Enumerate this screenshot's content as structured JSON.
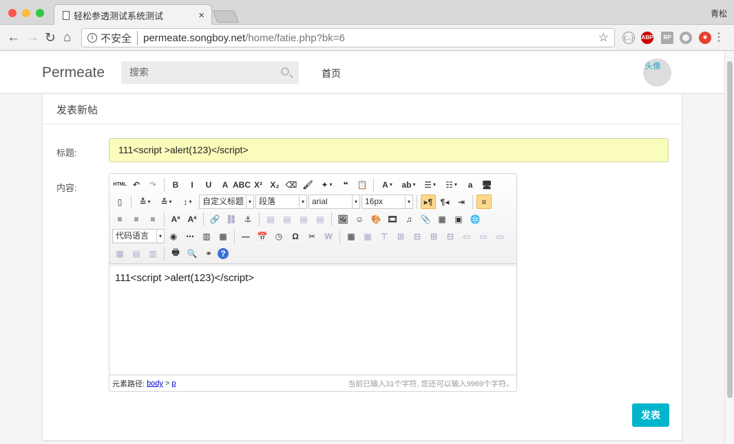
{
  "browser": {
    "tab_title": "轻松参透测试系统测试",
    "user": "青松",
    "security": "不安全",
    "url_host": "permeate.songboy.net",
    "url_path": "/home/fatie.php?bk=6"
  },
  "navbar": {
    "brand": "Permeate",
    "search_placeholder": "搜索",
    "home": "首页",
    "avatar_alt": "头像"
  },
  "form": {
    "heading": "发表新帖",
    "title_label": "标题:",
    "title_value": "111<script >alert(123)</script>",
    "content_label": "内容:",
    "submit": "发表"
  },
  "editor": {
    "selects": {
      "heading": "自定义标题",
      "paragraph": "段落",
      "font": "arial",
      "size": "16px",
      "code": "代码语言"
    },
    "body": "111<script >alert(123)</script>",
    "path_label": "元素路径:",
    "path_body": "body",
    "path_sep": ">",
    "path_p": "p",
    "count": "当前已输入31个字符, 您还可以输入9969个字符。",
    "rows": [
      [
        [
          "html",
          "HTML"
        ],
        [
          "undo",
          "↶"
        ],
        [
          "redo",
          "↷",
          1
        ],
        "|",
        [
          "bold",
          "B"
        ],
        [
          "italic",
          "I"
        ],
        [
          "underline",
          "U"
        ],
        [
          "fontborder",
          "A"
        ],
        [
          "strikethrough",
          "ABC"
        ],
        [
          "superscript",
          "X²"
        ],
        [
          "subscript",
          "X₂"
        ],
        [
          "removeformat",
          "⌫"
        ],
        [
          "formatmatch",
          "🖌"
        ],
        [
          "autotypeset",
          "✦",
          0,
          "dd"
        ],
        [
          "blockquote",
          "❝"
        ],
        [
          "pasteplain",
          "📋"
        ],
        "|",
        [
          "forecolor",
          "A",
          0,
          "dd"
        ],
        [
          "backcolor",
          "ab",
          0,
          "dd"
        ],
        [
          "ordered-list",
          "☰",
          0,
          "dd"
        ],
        [
          "unordered-list",
          "☷",
          0,
          "dd"
        ],
        [
          "selectall",
          "a"
        ],
        [
          "preview",
          "🖥"
        ]
      ],
      [
        [
          "cleardoc",
          "▯"
        ],
        "|",
        [
          "rowspacing-top",
          "≛",
          0,
          "dd"
        ],
        [
          "rowspacing-bottom",
          "≚",
          0,
          "dd"
        ],
        [
          "lineheight",
          "↕",
          0,
          "dd"
        ],
        "S:heading:80",
        "S:paragraph:75",
        "S:font:75",
        "S:size:75",
        "|",
        [
          "ltr",
          "▸¶",
          0,
          "act"
        ],
        [
          "rtl",
          "¶◂"
        ],
        [
          "indent",
          "⇥"
        ],
        "|",
        [
          "justifyleft",
          "≡",
          0,
          "act"
        ]
      ],
      [
        [
          "justifycenter",
          "≡"
        ],
        [
          "justifyright",
          "≡"
        ],
        [
          "justifyjustify",
          "≡"
        ],
        "|",
        [
          "touppercase",
          "Aª"
        ],
        [
          "tolowercase",
          "Aª"
        ],
        "|",
        [
          "link",
          "🔗"
        ],
        [
          "unlink",
          "⛓",
          1
        ],
        [
          "anchor",
          "⚓"
        ],
        "|",
        [
          "imagenone",
          "▤",
          1
        ],
        [
          "imageleft",
          "▤",
          1
        ],
        [
          "imageright",
          "▤",
          1
        ],
        [
          "imagecenter",
          "▤",
          1
        ],
        "|",
        [
          "image",
          "🖼"
        ],
        [
          "emotion",
          "☺"
        ],
        [
          "scrawl",
          "🎨"
        ],
        [
          "video",
          "🎞"
        ],
        [
          "music",
          "♫"
        ],
        [
          "attachment",
          "📎"
        ],
        [
          "map",
          "▦"
        ],
        [
          "gmap",
          "▣"
        ],
        [
          "insertframe",
          "🌐"
        ]
      ],
      [
        "S:code:76",
        [
          "webapp",
          "◉"
        ],
        [
          "pagebreak",
          "⋯"
        ],
        [
          "template",
          "▥"
        ],
        [
          "background",
          "▩"
        ],
        "|",
        [
          "horizontal",
          "—"
        ],
        [
          "date",
          "📅"
        ],
        [
          "time",
          "◷"
        ],
        [
          "spechars",
          "Ω"
        ],
        [
          "wordimage",
          "✂"
        ],
        [
          "snapscreen",
          "W",
          1
        ],
        "|",
        [
          "inserttable",
          "▦"
        ],
        [
          "deletetable",
          "▦",
          1
        ],
        [
          "insertparagraph",
          "⊤",
          1
        ],
        [
          "insertrow",
          "⊞",
          1
        ],
        [
          "deleterow",
          "⊟",
          1
        ],
        [
          "insertcol",
          "⊞",
          1
        ],
        [
          "deletecol",
          "⊟",
          1
        ],
        [
          "mergecells",
          "▭",
          1
        ],
        [
          "mergeright",
          "▭",
          1
        ],
        [
          "mergedown",
          "▭",
          1
        ]
      ],
      [
        [
          "splittocells",
          "▦",
          1
        ],
        [
          "splittorows",
          "▤",
          1
        ],
        [
          "splittocols",
          "▥",
          1
        ],
        "|",
        [
          "print",
          "🖶"
        ],
        [
          "search-preview",
          "🔍"
        ],
        [
          "searchreplace",
          "⚭"
        ],
        [
          "help",
          "?"
        ]
      ]
    ]
  },
  "colors": {
    "accent": "#00b4cc",
    "title_bg": "#fafcbb"
  }
}
